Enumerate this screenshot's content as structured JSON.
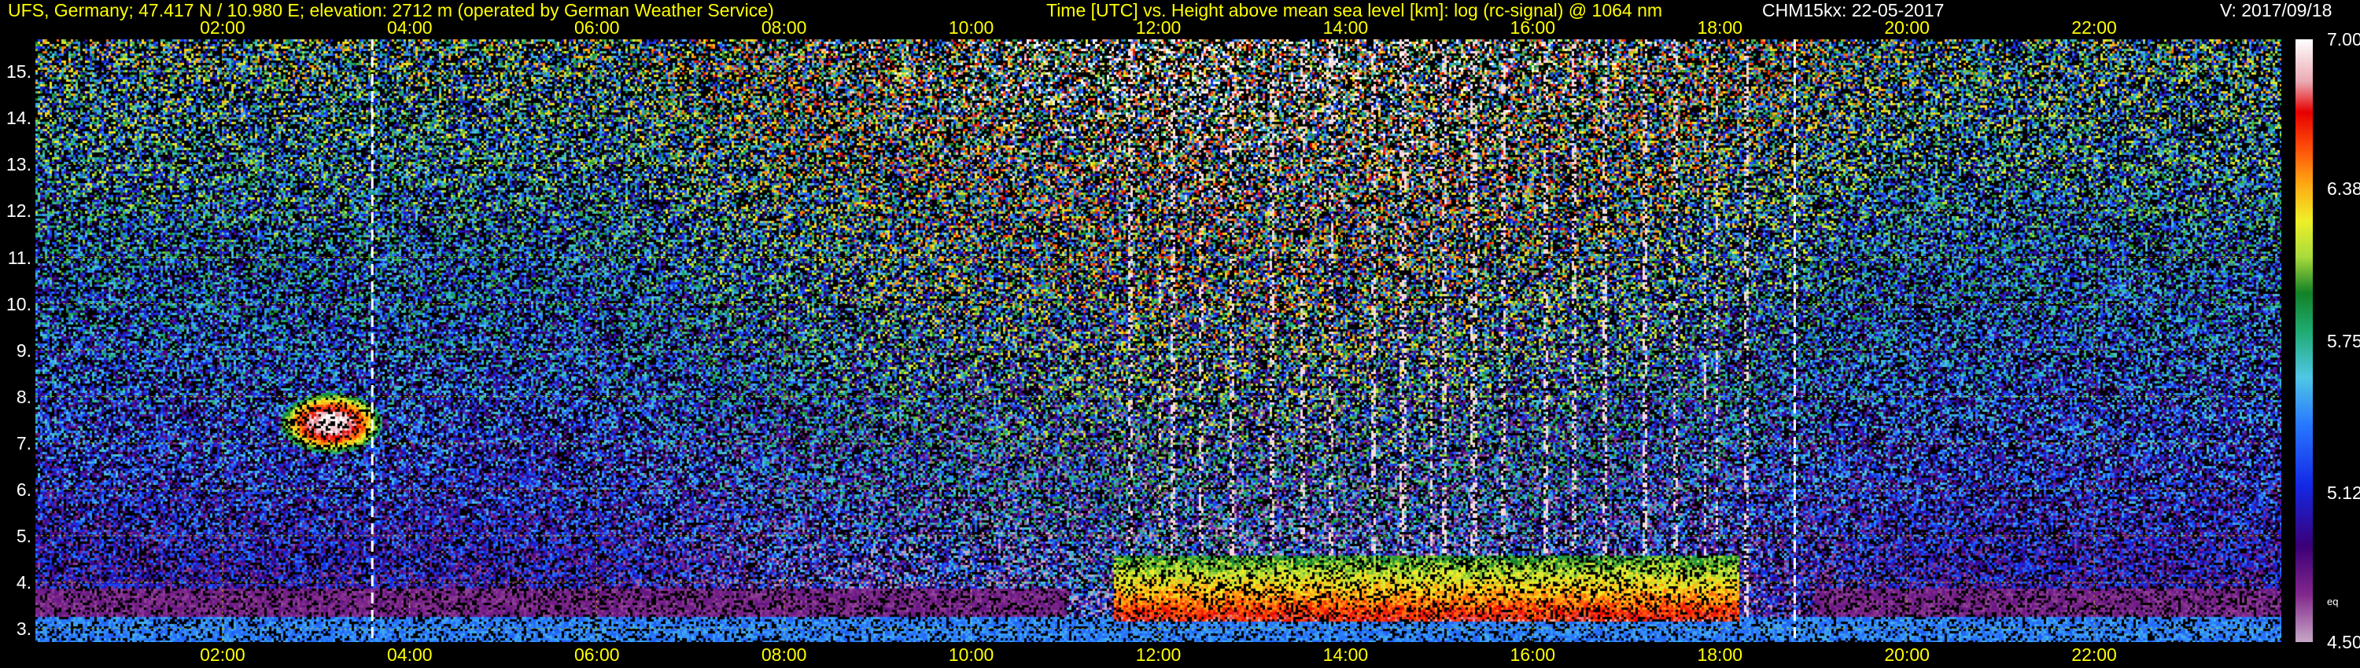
{
  "header": {
    "station": "UFS, Germany; 47.417 N / 10.980 E; elevation: 2712 m  (operated by German Weather Service)",
    "plot_title": "Time [UTC] vs. Height above mean sea level [km]: log (rc-signal) @ 1064 nm",
    "instrument_date": "CHM15kx: 22-05-2017",
    "version": "V: 2017/09/18"
  },
  "chart_data": {
    "type": "heatmap",
    "title": "Time [UTC] vs. Height above mean sea level [km]: log (rc-signal) @ 1064 nm",
    "xlabel": "Time [UTC]",
    "ylabel": "Height above mean sea level [km]",
    "x_tick_labels": [
      "02:00",
      "04:00",
      "06:00",
      "08:00",
      "10:00",
      "12:00",
      "14:00",
      "16:00",
      "18:00",
      "20:00",
      "22:00"
    ],
    "x_tick_hours": [
      2,
      4,
      6,
      8,
      10,
      12,
      14,
      16,
      18,
      20,
      22
    ],
    "xlim_hours": [
      0,
      24
    ],
    "y_ticks": [
      "3.",
      "4.",
      "5.",
      "6.",
      "7.",
      "8.",
      "9.",
      "10.",
      "11.",
      "12.",
      "13.",
      "14.",
      "15."
    ],
    "y_tick_values": [
      3,
      4,
      5,
      6,
      7,
      8,
      9,
      10,
      11,
      12,
      13,
      14,
      15
    ],
    "ylim_km": [
      2.71,
      15.7
    ],
    "grid": true,
    "grid_color": "#c8c800",
    "vertical_markers_hours": [
      3.6,
      18.8
    ],
    "colorbar": {
      "labels": [
        "7.00",
        "6.38",
        "5.75",
        "5.12",
        "4.50"
      ],
      "values": [
        7.0,
        6.38,
        5.75,
        5.12,
        4.5
      ],
      "unit_label": "eq",
      "range": [
        4.5,
        7.0
      ]
    },
    "features": {
      "cloud_layer": {
        "x_hours": [
          2.6,
          3.7
        ],
        "y_km": [
          6.8,
          8.1
        ]
      },
      "convective_boundary_layer": {
        "x_hours": [
          11.5,
          18.2
        ],
        "top_km": 4.6
      },
      "snow_band_hours": [
        11.5,
        18.5
      ]
    }
  },
  "colors": {
    "background": "#000000",
    "header_text": "#ffff00",
    "axis_text": "#ffffff",
    "tick_text": "#ffff00"
  }
}
